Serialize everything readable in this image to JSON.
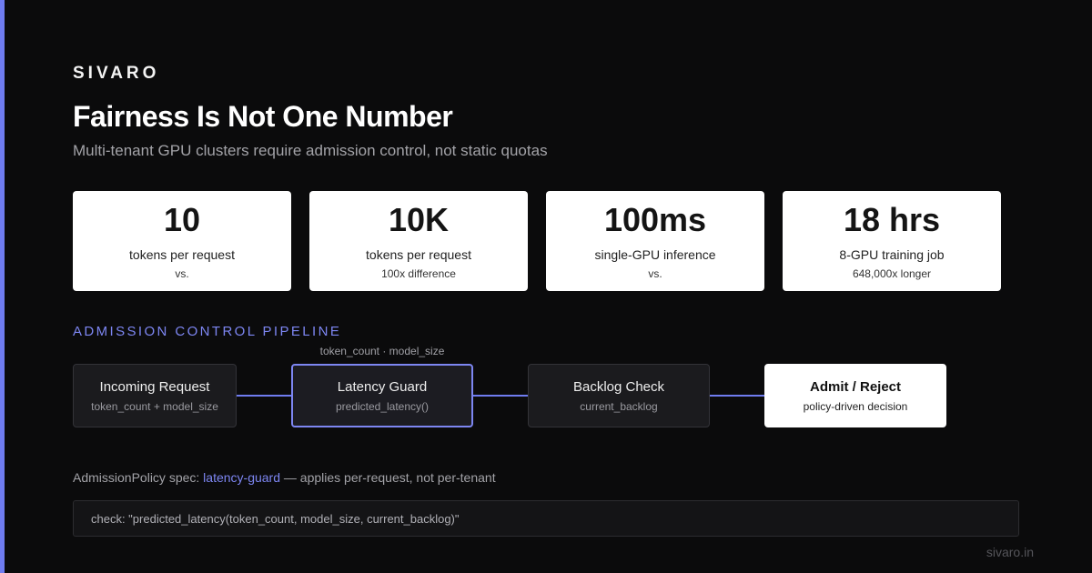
{
  "brand": "SIVARO",
  "title": "Fairness Is Not One Number",
  "subtitle": "Multi-tenant GPU clusters require admission control, not static quotas",
  "stats": [
    {
      "value": "10",
      "label": "tokens per request",
      "note": "vs."
    },
    {
      "value": "10K",
      "label": "tokens per request",
      "note": "100x difference"
    },
    {
      "value": "100ms",
      "label": "single-GPU inference",
      "note": "vs."
    },
    {
      "value": "18 hrs",
      "label": "8-GPU training job",
      "note": "648,000x longer"
    }
  ],
  "pipeline": {
    "section_label": "ADMISSION CONTROL PIPELINE",
    "floating_note": "token_count · model_size",
    "nodes": [
      {
        "title": "Incoming Request",
        "sub": "token_count + model_size"
      },
      {
        "title": "Latency Guard",
        "sub": "predicted_latency()"
      },
      {
        "title": "Backlog Check",
        "sub": "current_backlog"
      },
      {
        "title": "Admit / Reject",
        "sub": "policy-driven decision"
      }
    ]
  },
  "spec": {
    "prefix": "AdmissionPolicy spec: ",
    "policy": "latency-guard",
    "suffix": " — applies per-request, not per-tenant"
  },
  "code": "check: \"predicted_latency(token_count, model_size, current_backlog)\"",
  "footer": "sivaro.in",
  "colors": {
    "accent": "#6f7cf0",
    "background": "#0b0b0c",
    "card": "#ffffff"
  }
}
